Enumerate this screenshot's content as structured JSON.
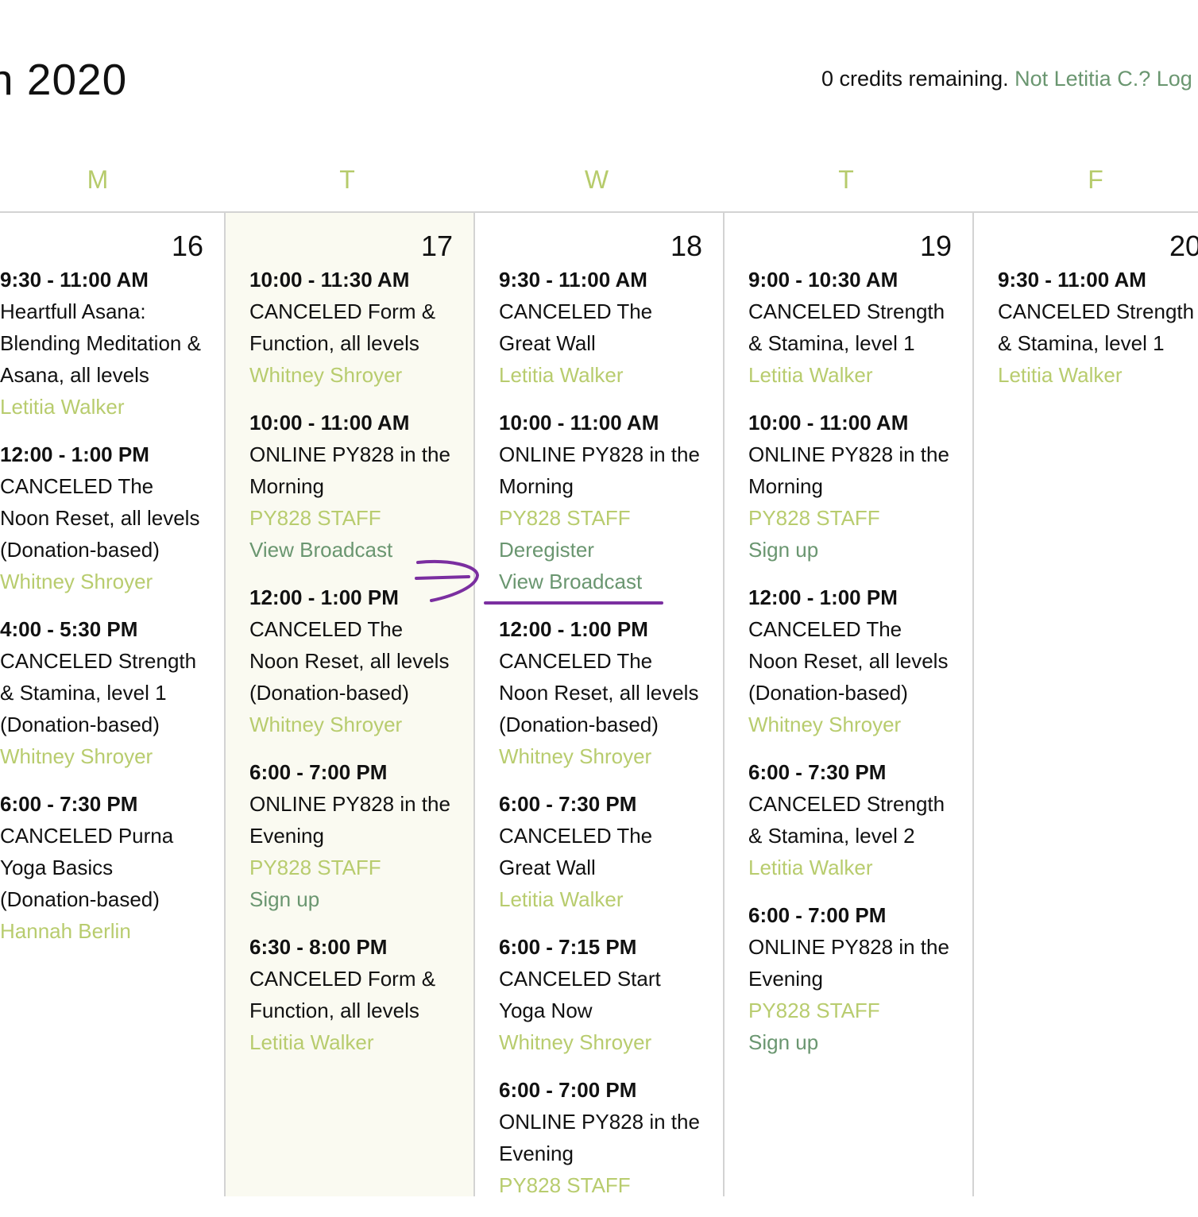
{
  "header": {
    "title": "h 2020",
    "credits_text": "0 credits remaining.",
    "account_link": "Not Letitia C.? Log"
  },
  "colors": {
    "day_letter": "#b6cb6b",
    "teacher_link": "#b8cc6e",
    "action_link": "#6a9670",
    "today_background": "#fafaf1",
    "annotation": "#7b2fa0"
  },
  "days": [
    {
      "letter": "M",
      "date": "16",
      "today": false,
      "events": [
        {
          "time": "9:30 - 11:00 AM",
          "title_lines": [
            "Heartfull Asana:",
            "Blending Meditation &",
            "Asana, all levels"
          ],
          "teacher": "Letitia Walker",
          "actions": []
        },
        {
          "time": "12:00 - 1:00 PM",
          "title_lines": [
            "CANCELED The",
            "Noon Reset, all levels",
            "(Donation-based)"
          ],
          "teacher": "Whitney Shroyer",
          "actions": []
        },
        {
          "time": "4:00 - 5:30 PM",
          "title_lines": [
            "CANCELED Strength",
            "& Stamina, level 1",
            "(Donation-based)"
          ],
          "teacher": "Whitney Shroyer",
          "actions": []
        },
        {
          "time": "6:00 - 7:30 PM",
          "title_lines": [
            "CANCELED Purna",
            "Yoga Basics",
            "(Donation-based)"
          ],
          "teacher": "Hannah Berlin",
          "actions": []
        }
      ]
    },
    {
      "letter": "T",
      "date": "17",
      "today": true,
      "events": [
        {
          "time": "10:00 - 11:30 AM",
          "title_lines": [
            "CANCELED Form &",
            "Function, all levels"
          ],
          "teacher": "Whitney Shroyer",
          "actions": []
        },
        {
          "time": "10:00 - 11:00 AM",
          "title_lines": [
            "ONLINE PY828 in the",
            "Morning"
          ],
          "teacher": "PY828 STAFF",
          "actions": [
            "View Broadcast"
          ]
        },
        {
          "time": "12:00 - 1:00 PM",
          "title_lines": [
            "CANCELED The",
            "Noon Reset, all levels",
            "(Donation-based)"
          ],
          "teacher": "Whitney Shroyer",
          "actions": []
        },
        {
          "time": "6:00 - 7:00 PM",
          "title_lines": [
            "ONLINE PY828 in the",
            "Evening"
          ],
          "teacher": "PY828 STAFF",
          "actions": [
            "Sign up"
          ]
        },
        {
          "time": "6:30 - 8:00 PM",
          "title_lines": [
            "CANCELED Form &",
            "Function, all levels"
          ],
          "teacher": "Letitia Walker",
          "actions": []
        }
      ]
    },
    {
      "letter": "W",
      "date": "18",
      "today": false,
      "events": [
        {
          "time": "9:30 - 11:00 AM",
          "title_lines": [
            "CANCELED The",
            "Great Wall"
          ],
          "teacher": "Letitia Walker",
          "actions": []
        },
        {
          "time": "10:00 - 11:00 AM",
          "title_lines": [
            "ONLINE PY828 in the",
            "Morning"
          ],
          "teacher": "PY828 STAFF",
          "actions": [
            "Deregister",
            "View Broadcast"
          ]
        },
        {
          "time": "12:00 - 1:00 PM",
          "title_lines": [
            "CANCELED The",
            "Noon Reset, all levels",
            "(Donation-based)"
          ],
          "teacher": "Whitney Shroyer",
          "actions": []
        },
        {
          "time": "6:00 - 7:30 PM",
          "title_lines": [
            "CANCELED The",
            "Great Wall"
          ],
          "teacher": "Letitia Walker",
          "actions": []
        },
        {
          "time": "6:00 - 7:15 PM",
          "title_lines": [
            "CANCELED Start",
            "Yoga Now"
          ],
          "teacher": "Whitney Shroyer",
          "actions": []
        },
        {
          "time": "6:00 - 7:00 PM",
          "title_lines": [
            "ONLINE PY828 in the",
            "Evening"
          ],
          "teacher": "PY828 STAFF",
          "actions": []
        }
      ]
    },
    {
      "letter": "T",
      "date": "19",
      "today": false,
      "events": [
        {
          "time": "9:00 - 10:30 AM",
          "title_lines": [
            "CANCELED Strength",
            "& Stamina, level 1"
          ],
          "teacher": "Letitia Walker",
          "actions": []
        },
        {
          "time": "10:00 - 11:00 AM",
          "title_lines": [
            "ONLINE PY828 in the",
            "Morning"
          ],
          "teacher": "PY828 STAFF",
          "actions": [
            "Sign up"
          ]
        },
        {
          "time": "12:00 - 1:00 PM",
          "title_lines": [
            "CANCELED The",
            "Noon Reset, all levels",
            "(Donation-based)"
          ],
          "teacher": "Whitney Shroyer",
          "actions": []
        },
        {
          "time": "6:00 - 7:30 PM",
          "title_lines": [
            "CANCELED Strength",
            "& Stamina, level 2"
          ],
          "teacher": "Letitia Walker",
          "actions": []
        },
        {
          "time": "6:00 - 7:00 PM",
          "title_lines": [
            "ONLINE PY828 in the",
            "Evening"
          ],
          "teacher": "PY828 STAFF",
          "actions": [
            "Sign up"
          ]
        }
      ]
    },
    {
      "letter": "F",
      "date": "20",
      "today": false,
      "events": [
        {
          "time": "9:30 - 11:00 AM",
          "title_lines": [
            "CANCELED Strength",
            "& Stamina, level 1"
          ],
          "teacher": "Letitia Walker",
          "actions": []
        }
      ]
    }
  ]
}
